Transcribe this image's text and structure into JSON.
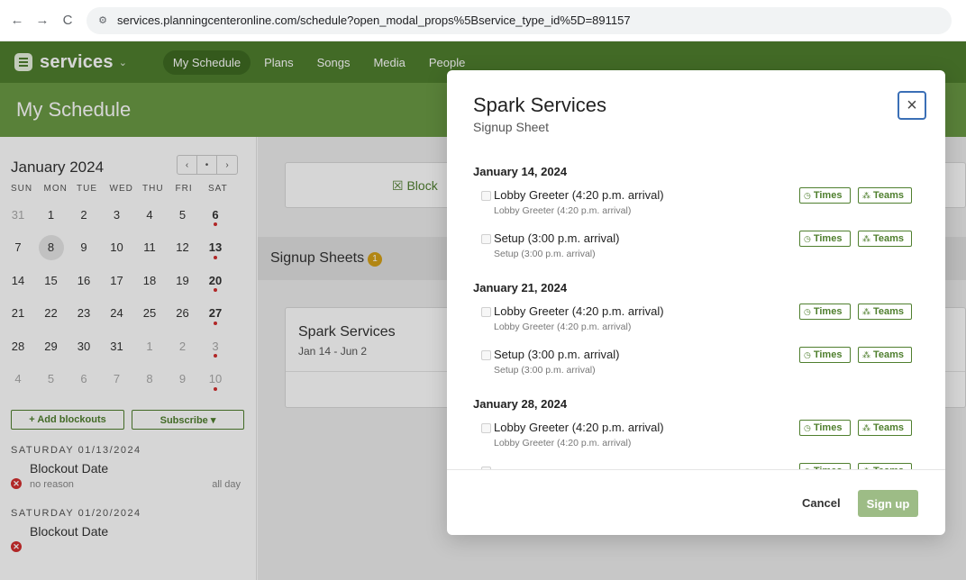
{
  "browser": {
    "back_icon": "←",
    "forward_icon": "→",
    "reload_icon": "C",
    "url": "services.planningcenteronline.com/schedule?open_modal_props%5Bservice_type_id%5D=891157"
  },
  "app": {
    "name": "services",
    "chevron": "⌄",
    "nav": [
      "My Schedule",
      "Plans",
      "Songs",
      "Media",
      "People"
    ],
    "active_nav": "My Schedule"
  },
  "page": {
    "title": "My Schedule"
  },
  "calendar": {
    "month_label": "January 2024",
    "controls": [
      "‹",
      "•",
      "›"
    ],
    "weekdays": [
      "SUN",
      "MON",
      "TUE",
      "WED",
      "THU",
      "FRI",
      "SAT"
    ],
    "weeks": [
      [
        {
          "d": "31",
          "m": true
        },
        {
          "d": "1"
        },
        {
          "d": "2"
        },
        {
          "d": "3"
        },
        {
          "d": "4"
        },
        {
          "d": "5"
        },
        {
          "d": "6",
          "b": true,
          "dot": true
        }
      ],
      [
        {
          "d": "7"
        },
        {
          "d": "8",
          "today": true
        },
        {
          "d": "9"
        },
        {
          "d": "10"
        },
        {
          "d": "11"
        },
        {
          "d": "12"
        },
        {
          "d": "13",
          "b": true,
          "dot": true
        }
      ],
      [
        {
          "d": "14"
        },
        {
          "d": "15"
        },
        {
          "d": "16"
        },
        {
          "d": "17"
        },
        {
          "d": "18"
        },
        {
          "d": "19"
        },
        {
          "d": "20",
          "b": true,
          "dot": true
        }
      ],
      [
        {
          "d": "21"
        },
        {
          "d": "22"
        },
        {
          "d": "23"
        },
        {
          "d": "24"
        },
        {
          "d": "25"
        },
        {
          "d": "26"
        },
        {
          "d": "27",
          "b": true,
          "dot": true
        }
      ],
      [
        {
          "d": "28"
        },
        {
          "d": "29"
        },
        {
          "d": "30"
        },
        {
          "d": "31"
        },
        {
          "d": "1",
          "m": true
        },
        {
          "d": "2",
          "m": true
        },
        {
          "d": "3",
          "m": true,
          "dot": true
        }
      ],
      [
        {
          "d": "4",
          "m": true
        },
        {
          "d": "5",
          "m": true
        },
        {
          "d": "6",
          "m": true
        },
        {
          "d": "7",
          "m": true
        },
        {
          "d": "8",
          "m": true
        },
        {
          "d": "9",
          "m": true
        },
        {
          "d": "10",
          "m": true,
          "dot": true
        }
      ]
    ]
  },
  "sidebar": {
    "add_blockouts": "+ Add blockouts",
    "subscribe": "Subscribe ▾",
    "sections": [
      {
        "header": "SATURDAY 01/13/2024",
        "title": "Blockout Date",
        "reason": "no reason",
        "when": "all day"
      },
      {
        "header": "SATURDAY 01/20/2024",
        "title": "Blockout Date"
      }
    ]
  },
  "main": {
    "block_label": "Block",
    "signup_sheets_label": "Signup Sheets",
    "signup_sheets_count": "1",
    "card_name": "Spark Services",
    "card_dates": "Jan 14 - Jun 2"
  },
  "modal": {
    "title": "Spark Services",
    "subtitle": "Signup Sheet",
    "close_icon": "×",
    "groups": [
      {
        "date": "January 14, 2024",
        "items": [
          {
            "name": "Lobby Greeter (4:20 p.m. arrival)",
            "desc": "Lobby Greeter (4:20 p.m. arrival)"
          },
          {
            "name": "Setup (3:00 p.m. arrival)",
            "desc": "Setup (3:00 p.m. arrival)"
          }
        ]
      },
      {
        "date": "January 21, 2024",
        "items": [
          {
            "name": "Lobby Greeter (4:20 p.m. arrival)",
            "desc": "Lobby Greeter (4:20 p.m. arrival)"
          },
          {
            "name": "Setup (3:00 p.m. arrival)",
            "desc": "Setup (3:00 p.m. arrival)"
          }
        ]
      },
      {
        "date": "January 28, 2024",
        "items": [
          {
            "name": "Lobby Greeter (4:20 p.m. arrival)",
            "desc": "Lobby Greeter (4:20 p.m. arrival)"
          },
          {
            "name": "",
            "desc": ""
          }
        ]
      }
    ],
    "times_label": "Times",
    "teams_label": "Teams",
    "times_icon": "◷",
    "teams_icon": "⁂",
    "cancel_label": "Cancel",
    "signup_label": "Sign up"
  },
  "colors": {
    "header_green": "#4f7f2e",
    "title_band_green": "#6b9a45",
    "tag_green": "#4f7f2e",
    "signup_disabled": "#9dbc86",
    "dot_red": "#d32f2f"
  }
}
